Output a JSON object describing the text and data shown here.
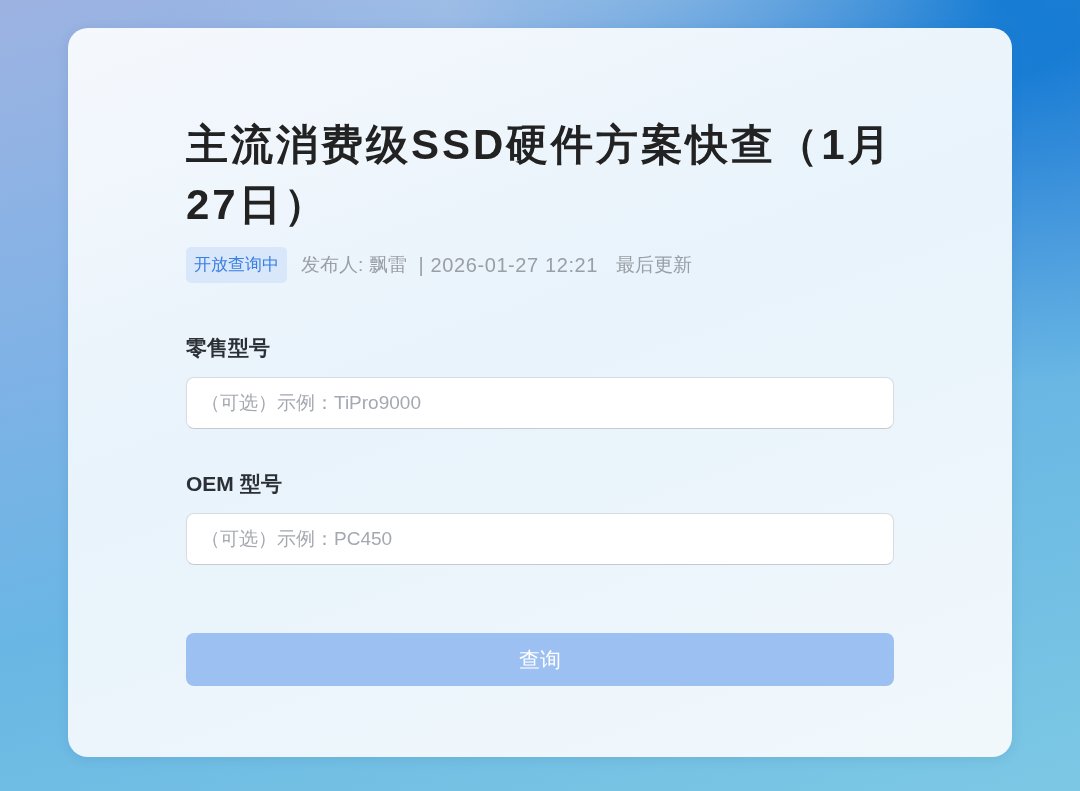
{
  "page": {
    "title": "主流消费级SSD硬件方案快查（1月27日）",
    "status_badge": "开放查询中",
    "publisher": "发布人: 飘雷",
    "published": "| 2026-01-27 12:21",
    "update_note": "最后更新"
  },
  "fields": [
    {
      "label": "零售型号",
      "placeholder": "（可选）示例：TiPro9000"
    },
    {
      "label": "OEM 型号",
      "placeholder": "（可选）示例：PC450"
    }
  ],
  "submit_button": {
    "label": "查询",
    "disabled": true
  }
}
